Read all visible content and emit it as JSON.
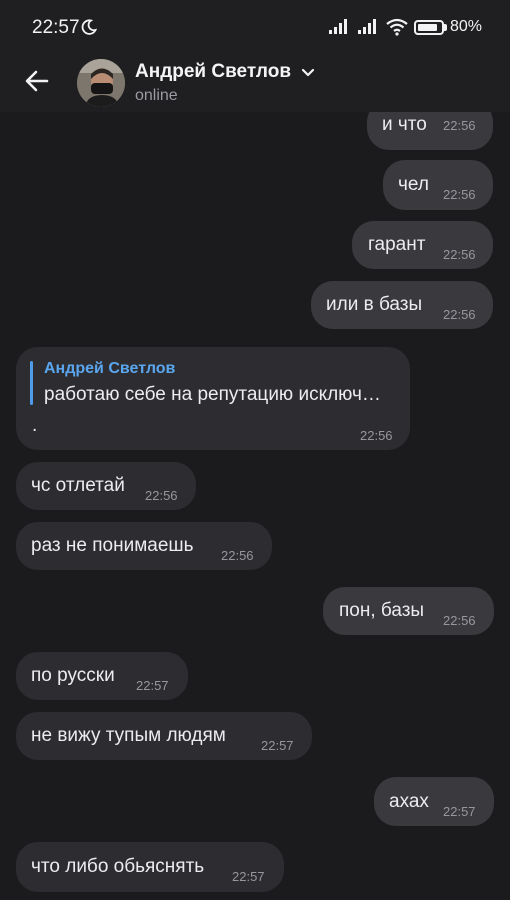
{
  "status": {
    "time": "22:57",
    "battery": "80%"
  },
  "header": {
    "name": "Андрей Светлов",
    "presence": "online"
  },
  "messages": [
    {
      "dir": "out",
      "text": "и что",
      "time": "22:56"
    },
    {
      "dir": "out",
      "text": "чел",
      "time": "22:56"
    },
    {
      "dir": "out",
      "text": "гарант",
      "time": "22:56"
    },
    {
      "dir": "out",
      "text": "или в базы",
      "time": "22:56"
    },
    {
      "dir": "in",
      "reply_name": "Андрей Светлов",
      "reply_text": "работаю себе на репутацию исключ…",
      "text": ".",
      "time": "22:56"
    },
    {
      "dir": "in",
      "text": "чс отлетай",
      "time": "22:56"
    },
    {
      "dir": "in",
      "text": "раз не понимаешь",
      "time": "22:56"
    },
    {
      "dir": "out",
      "text": "пон, базы",
      "time": "22:56"
    },
    {
      "dir": "in",
      "text": "по русски",
      "time": "22:57"
    },
    {
      "dir": "in",
      "text": "не вижу тупым людям",
      "time": "22:57"
    },
    {
      "dir": "out",
      "text": "ахах",
      "time": "22:57"
    },
    {
      "dir": "in",
      "text": "что либо обьяснять",
      "time": "22:57"
    }
  ]
}
